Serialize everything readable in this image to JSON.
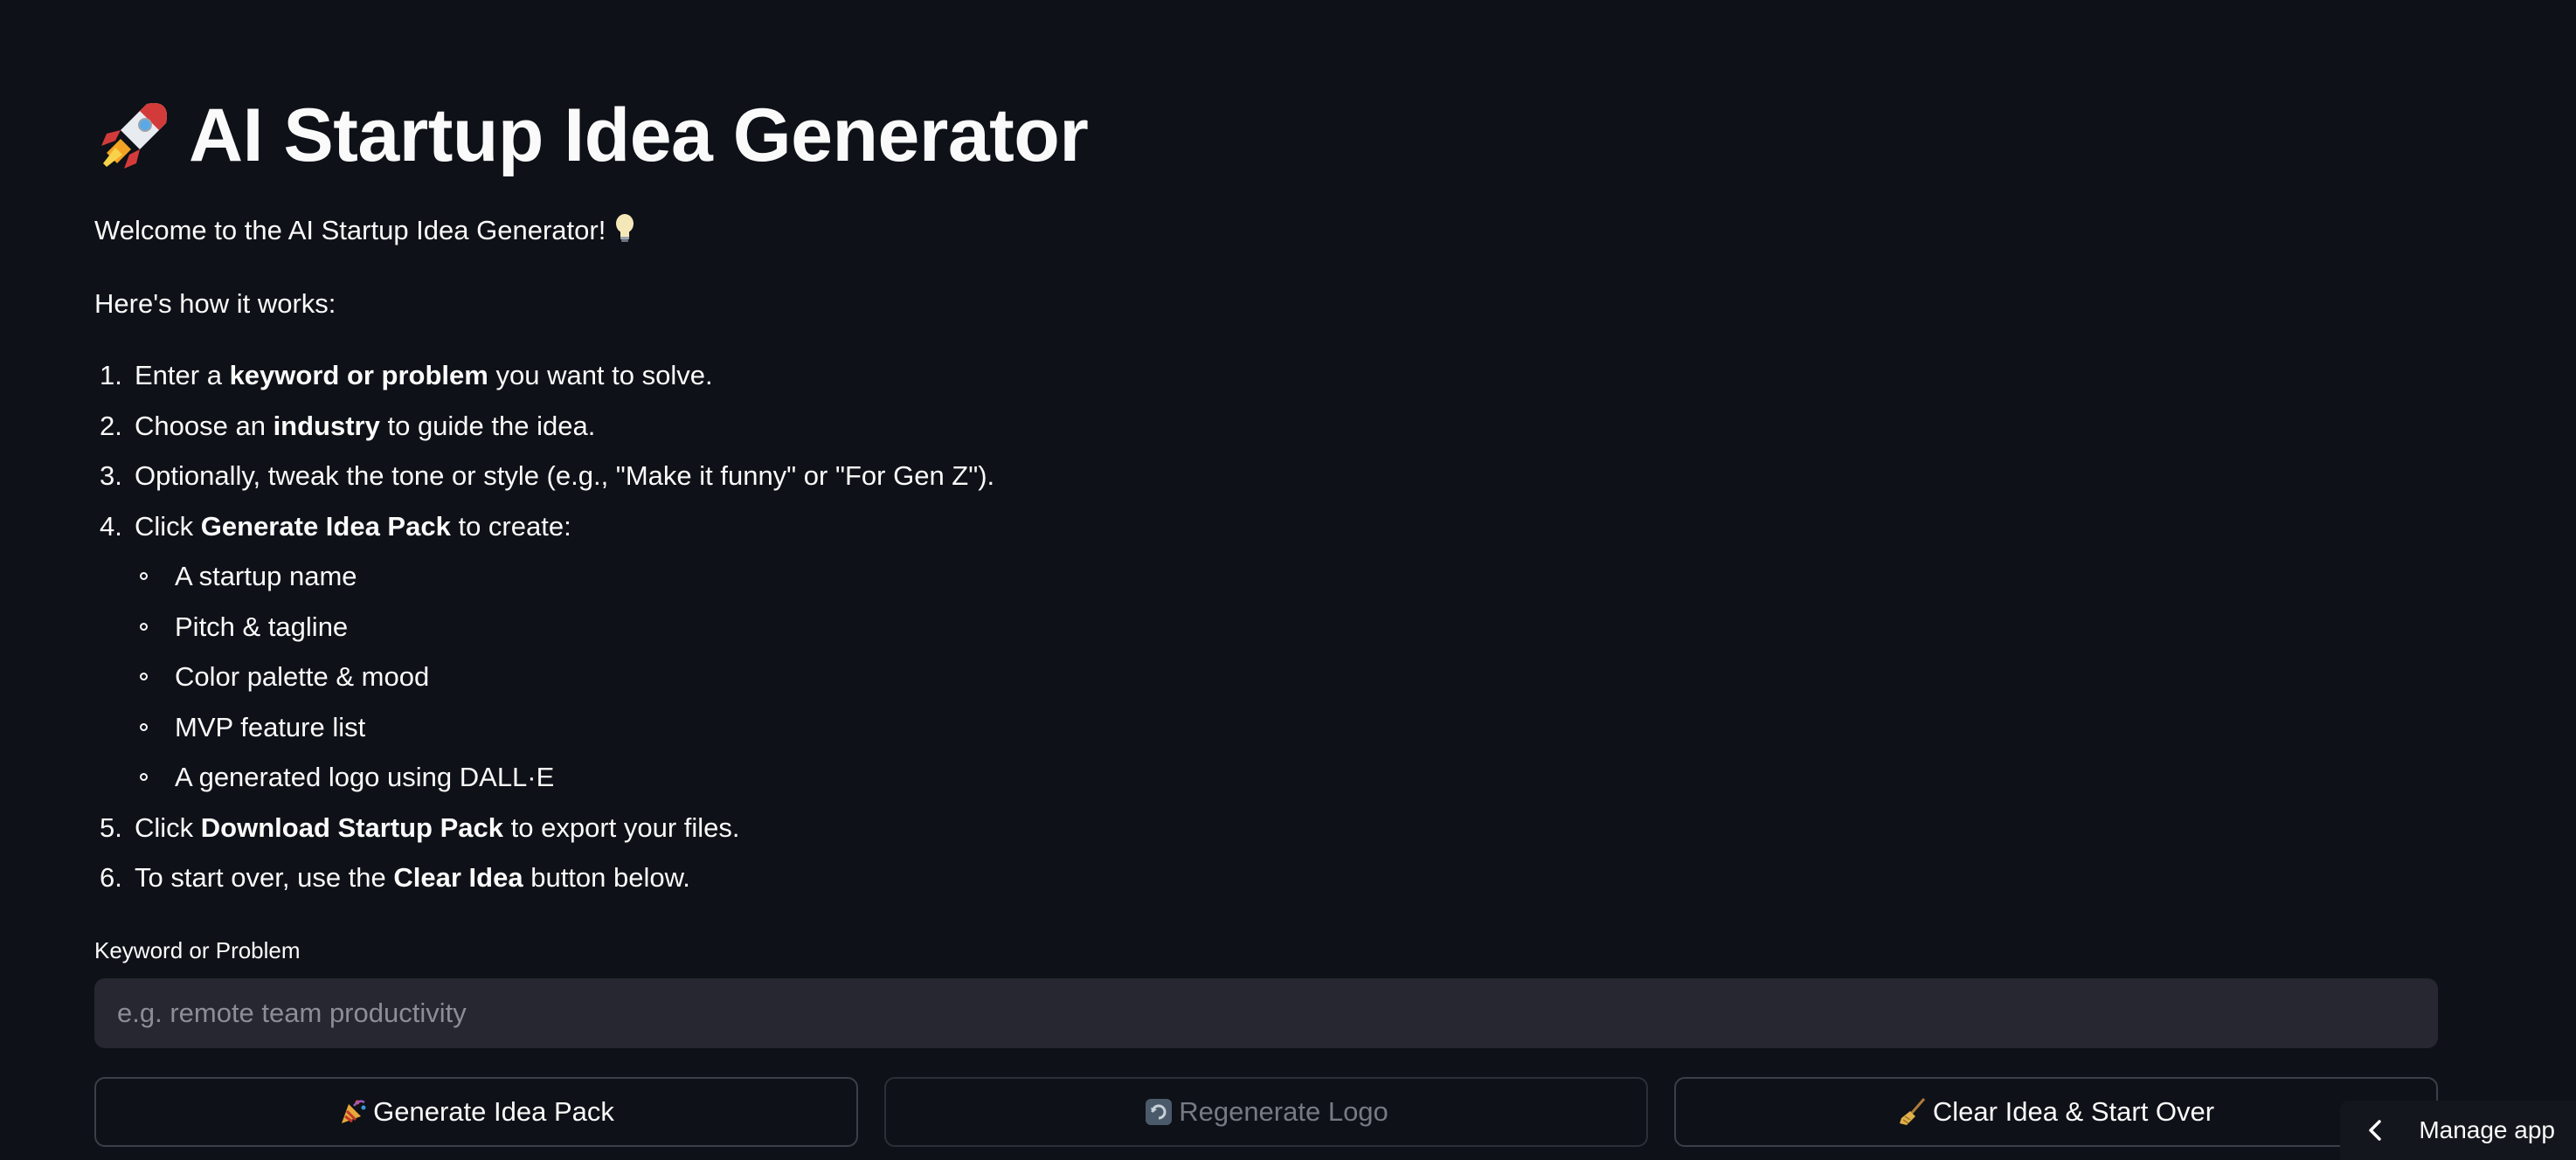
{
  "header": {
    "title": "AI Startup Idea Generator",
    "title_icon": "rocket-icon"
  },
  "intro": {
    "welcome": "Welcome to the AI Startup Idea Generator!",
    "welcome_icon": "lightbulb-icon",
    "how": "Here's how it works:"
  },
  "steps": [
    {
      "num": "1.",
      "pre": "Enter a ",
      "bold": "keyword or problem",
      "post": " you want to solve."
    },
    {
      "num": "2.",
      "pre": "Choose an ",
      "bold": "industry",
      "post": " to guide the idea."
    },
    {
      "num": "3.",
      "pre": "Optionally, tweak the tone or style (e.g., \"Make it funny\" or \"For Gen Z\").",
      "bold": "",
      "post": ""
    },
    {
      "num": "4.",
      "pre": "Click ",
      "bold": "Generate Idea Pack",
      "post": " to create:"
    },
    {
      "num": "5.",
      "pre": "Click ",
      "bold": "Download Startup Pack",
      "post": " to export your files."
    },
    {
      "num": "6.",
      "pre": "To start over, use the ",
      "bold": "Clear Idea",
      "post": " button below."
    }
  ],
  "sub_items": [
    "A startup name",
    "Pitch & tagline",
    "Color palette & mood",
    "MVP feature list",
    "A generated logo using DALL·E"
  ],
  "input": {
    "label": "Keyword or Problem",
    "value": "",
    "placeholder": "e.g. remote team productivity"
  },
  "buttons": {
    "generate": {
      "label": "Generate Idea Pack",
      "icon": "party-popper-icon"
    },
    "regenerate": {
      "label": "Regenerate Logo",
      "icon": "refresh-icon"
    },
    "clear": {
      "label": "Clear Idea & Start Over",
      "icon": "broom-icon"
    }
  },
  "manage_app": {
    "label": "Manage app",
    "icon": "chevron-left-icon"
  },
  "colors": {
    "background": "#0e1117",
    "text": "#fafafa",
    "input_bg": "#262730",
    "button_border": "#3c3f48"
  }
}
